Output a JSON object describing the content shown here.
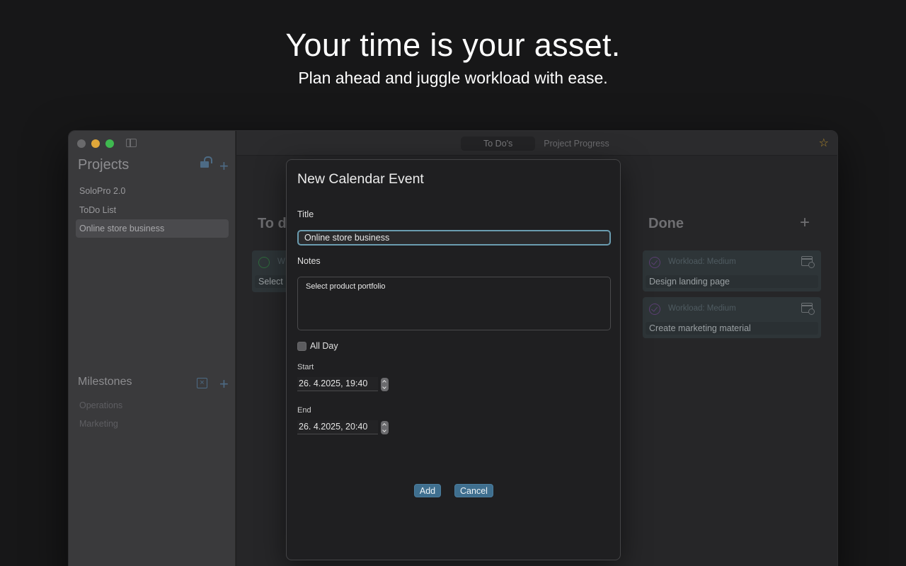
{
  "hero": {
    "headline": "Your time is your asset.",
    "subheadline": "Plan ahead and juggle workload with ease."
  },
  "sidebar": {
    "projects_title": "Projects",
    "projects": [
      {
        "label": "SoloPro 2.0",
        "selected": false
      },
      {
        "label": "ToDo List",
        "selected": false
      },
      {
        "label": "Online store business",
        "selected": true
      }
    ],
    "milestones_title": "Milestones",
    "milestones": [
      {
        "label": "Operations"
      },
      {
        "label": "Marketing"
      }
    ]
  },
  "toolbar": {
    "tabs": [
      {
        "label": "To Do's",
        "active": true
      },
      {
        "label": "Project Progress",
        "active": false
      }
    ]
  },
  "board": {
    "todo_title": "To d",
    "todo_card_text": "Select",
    "todo_card_wl": "W",
    "done_title": "Done",
    "done_cards": [
      {
        "workload": "Workload: Medium",
        "name": "Design landing page"
      },
      {
        "workload": "Workload: Medium",
        "name": "Create marketing material"
      }
    ]
  },
  "modal": {
    "title": "New Calendar Event",
    "title_label": "Title",
    "title_value": "Online store business",
    "notes_label": "Notes",
    "notes_value": "Select product portfolio",
    "all_day_label": "All Day",
    "all_day_checked": false,
    "start_label": "Start",
    "start_value": "26.  4.2025, 19:40",
    "end_label": "End",
    "end_value": "26.  4.2025, 20:40",
    "add_label": "Add",
    "cancel_label": "Cancel"
  },
  "colors": {
    "accent": "#3f6f8f",
    "focus_ring": "#6a9cb0",
    "star": "#b1892a"
  }
}
